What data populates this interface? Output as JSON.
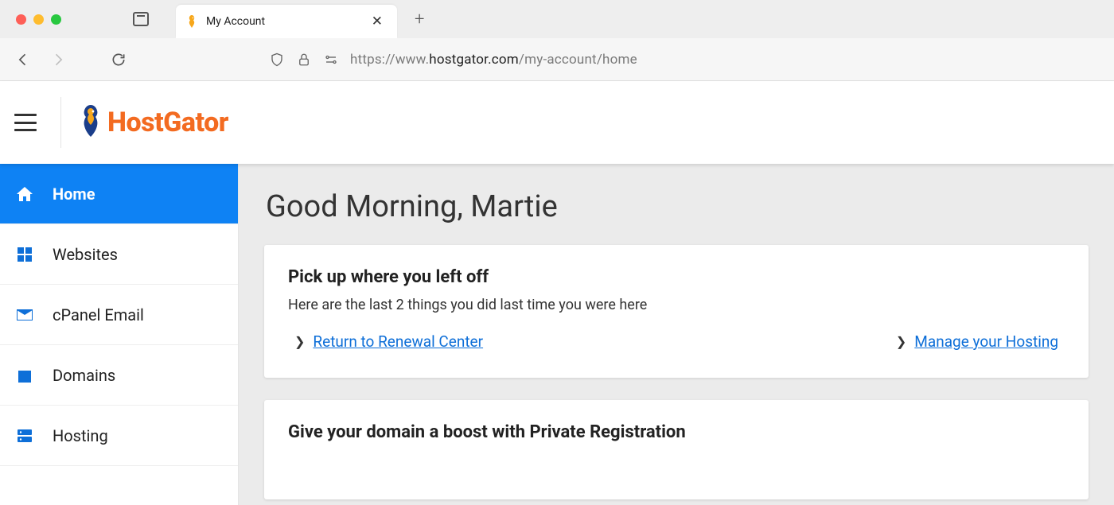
{
  "browser": {
    "tab_title": "My Account",
    "url_prefix": "https://www.",
    "url_host": "hostgator.com",
    "url_path": "/my-account/home"
  },
  "header": {
    "brand": "HostGator"
  },
  "sidebar": {
    "items": [
      {
        "key": "home",
        "label": "Home",
        "active": true
      },
      {
        "key": "websites",
        "label": "Websites",
        "active": false
      },
      {
        "key": "cpanel-email",
        "label": "cPanel Email",
        "active": false
      },
      {
        "key": "domains",
        "label": "Domains",
        "active": false
      },
      {
        "key": "hosting",
        "label": "Hosting",
        "active": false
      }
    ]
  },
  "main": {
    "greeting": "Good Morning, Martie",
    "pickup": {
      "title": "Pick up where you left off",
      "subtitle": "Here are the last 2 things you did last time you were here",
      "links": [
        {
          "label": "Return to Renewal Center"
        },
        {
          "label": "Manage your Hosting"
        }
      ]
    },
    "promo": {
      "title": "Give your domain a boost with Private Registration"
    }
  }
}
